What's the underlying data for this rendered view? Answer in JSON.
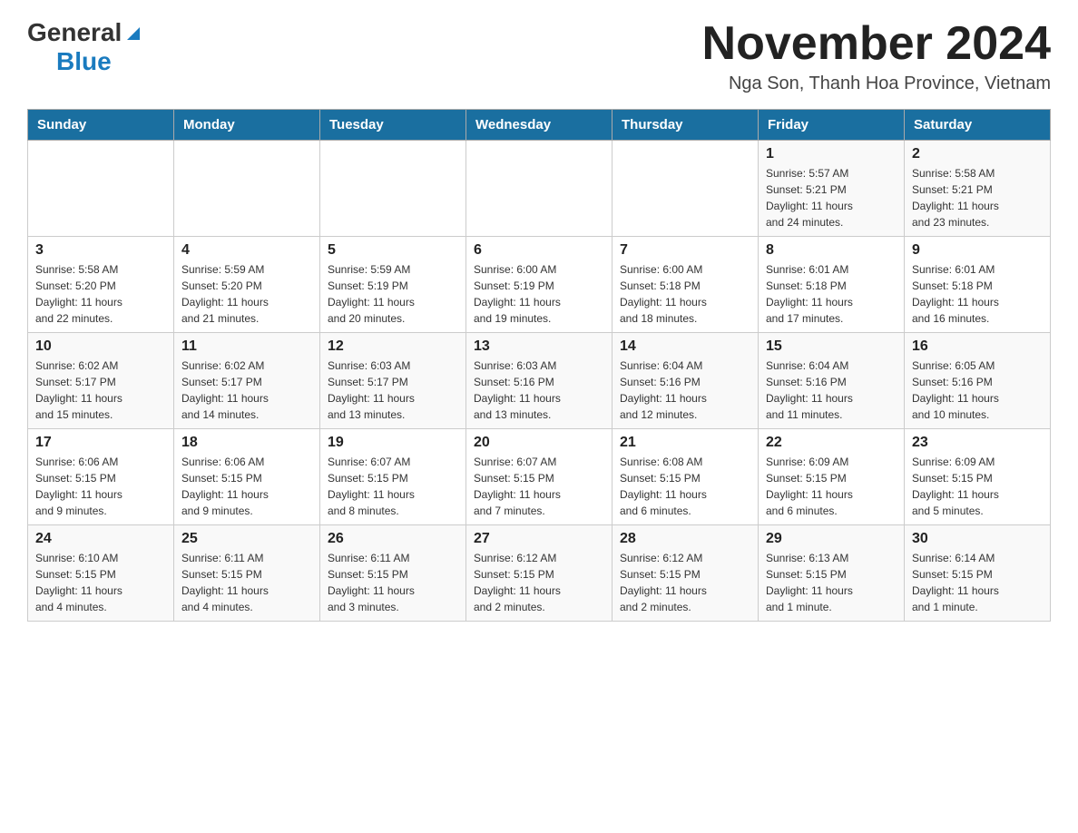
{
  "logo": {
    "general": "General",
    "blue": "Blue"
  },
  "title": "November 2024",
  "subtitle": "Nga Son, Thanh Hoa Province, Vietnam",
  "calendar": {
    "headers": [
      "Sunday",
      "Monday",
      "Tuesday",
      "Wednesday",
      "Thursday",
      "Friday",
      "Saturday"
    ],
    "weeks": [
      {
        "days": [
          {
            "num": "",
            "info": ""
          },
          {
            "num": "",
            "info": ""
          },
          {
            "num": "",
            "info": ""
          },
          {
            "num": "",
            "info": ""
          },
          {
            "num": "",
            "info": ""
          },
          {
            "num": "1",
            "info": "Sunrise: 5:57 AM\nSunset: 5:21 PM\nDaylight: 11 hours\nand 24 minutes."
          },
          {
            "num": "2",
            "info": "Sunrise: 5:58 AM\nSunset: 5:21 PM\nDaylight: 11 hours\nand 23 minutes."
          }
        ]
      },
      {
        "days": [
          {
            "num": "3",
            "info": "Sunrise: 5:58 AM\nSunset: 5:20 PM\nDaylight: 11 hours\nand 22 minutes."
          },
          {
            "num": "4",
            "info": "Sunrise: 5:59 AM\nSunset: 5:20 PM\nDaylight: 11 hours\nand 21 minutes."
          },
          {
            "num": "5",
            "info": "Sunrise: 5:59 AM\nSunset: 5:19 PM\nDaylight: 11 hours\nand 20 minutes."
          },
          {
            "num": "6",
            "info": "Sunrise: 6:00 AM\nSunset: 5:19 PM\nDaylight: 11 hours\nand 19 minutes."
          },
          {
            "num": "7",
            "info": "Sunrise: 6:00 AM\nSunset: 5:18 PM\nDaylight: 11 hours\nand 18 minutes."
          },
          {
            "num": "8",
            "info": "Sunrise: 6:01 AM\nSunset: 5:18 PM\nDaylight: 11 hours\nand 17 minutes."
          },
          {
            "num": "9",
            "info": "Sunrise: 6:01 AM\nSunset: 5:18 PM\nDaylight: 11 hours\nand 16 minutes."
          }
        ]
      },
      {
        "days": [
          {
            "num": "10",
            "info": "Sunrise: 6:02 AM\nSunset: 5:17 PM\nDaylight: 11 hours\nand 15 minutes."
          },
          {
            "num": "11",
            "info": "Sunrise: 6:02 AM\nSunset: 5:17 PM\nDaylight: 11 hours\nand 14 minutes."
          },
          {
            "num": "12",
            "info": "Sunrise: 6:03 AM\nSunset: 5:17 PM\nDaylight: 11 hours\nand 13 minutes."
          },
          {
            "num": "13",
            "info": "Sunrise: 6:03 AM\nSunset: 5:16 PM\nDaylight: 11 hours\nand 13 minutes."
          },
          {
            "num": "14",
            "info": "Sunrise: 6:04 AM\nSunset: 5:16 PM\nDaylight: 11 hours\nand 12 minutes."
          },
          {
            "num": "15",
            "info": "Sunrise: 6:04 AM\nSunset: 5:16 PM\nDaylight: 11 hours\nand 11 minutes."
          },
          {
            "num": "16",
            "info": "Sunrise: 6:05 AM\nSunset: 5:16 PM\nDaylight: 11 hours\nand 10 minutes."
          }
        ]
      },
      {
        "days": [
          {
            "num": "17",
            "info": "Sunrise: 6:06 AM\nSunset: 5:15 PM\nDaylight: 11 hours\nand 9 minutes."
          },
          {
            "num": "18",
            "info": "Sunrise: 6:06 AM\nSunset: 5:15 PM\nDaylight: 11 hours\nand 9 minutes."
          },
          {
            "num": "19",
            "info": "Sunrise: 6:07 AM\nSunset: 5:15 PM\nDaylight: 11 hours\nand 8 minutes."
          },
          {
            "num": "20",
            "info": "Sunrise: 6:07 AM\nSunset: 5:15 PM\nDaylight: 11 hours\nand 7 minutes."
          },
          {
            "num": "21",
            "info": "Sunrise: 6:08 AM\nSunset: 5:15 PM\nDaylight: 11 hours\nand 6 minutes."
          },
          {
            "num": "22",
            "info": "Sunrise: 6:09 AM\nSunset: 5:15 PM\nDaylight: 11 hours\nand 6 minutes."
          },
          {
            "num": "23",
            "info": "Sunrise: 6:09 AM\nSunset: 5:15 PM\nDaylight: 11 hours\nand 5 minutes."
          }
        ]
      },
      {
        "days": [
          {
            "num": "24",
            "info": "Sunrise: 6:10 AM\nSunset: 5:15 PM\nDaylight: 11 hours\nand 4 minutes."
          },
          {
            "num": "25",
            "info": "Sunrise: 6:11 AM\nSunset: 5:15 PM\nDaylight: 11 hours\nand 4 minutes."
          },
          {
            "num": "26",
            "info": "Sunrise: 6:11 AM\nSunset: 5:15 PM\nDaylight: 11 hours\nand 3 minutes."
          },
          {
            "num": "27",
            "info": "Sunrise: 6:12 AM\nSunset: 5:15 PM\nDaylight: 11 hours\nand 2 minutes."
          },
          {
            "num": "28",
            "info": "Sunrise: 6:12 AM\nSunset: 5:15 PM\nDaylight: 11 hours\nand 2 minutes."
          },
          {
            "num": "29",
            "info": "Sunrise: 6:13 AM\nSunset: 5:15 PM\nDaylight: 11 hours\nand 1 minute."
          },
          {
            "num": "30",
            "info": "Sunrise: 6:14 AM\nSunset: 5:15 PM\nDaylight: 11 hours\nand 1 minute."
          }
        ]
      }
    ]
  }
}
